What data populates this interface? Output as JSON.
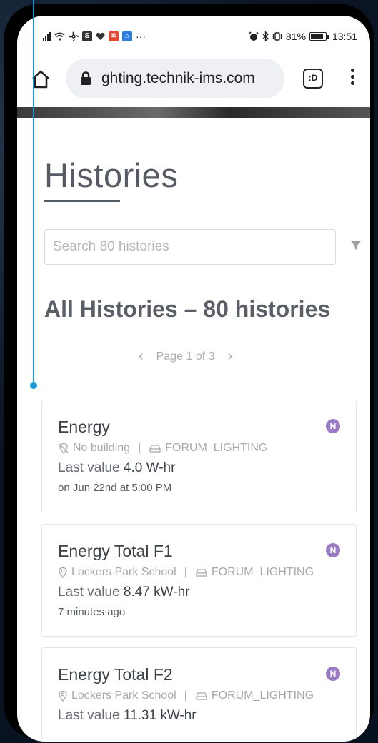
{
  "status_bar": {
    "time": "13:51",
    "battery_percent": "81%",
    "icons": [
      "signal-icon",
      "wifi-icon",
      "fan-icon",
      "s-app-icon",
      "heart-icon",
      "mail-icon",
      "home-app-icon",
      "more-dots-icon",
      "alarm-icon",
      "bluetooth-icon",
      "vibrate-icon",
      "battery-icon"
    ],
    "more_label": "···"
  },
  "browser": {
    "url": "ghting.technik-ims.com",
    "tab_label": ":D"
  },
  "page": {
    "title": "Histories",
    "search_placeholder": "Search 80 histories",
    "section_title": "All Histories – 80 histories",
    "pagination": {
      "label": "Page 1 of 3",
      "current": 1,
      "total": 3
    }
  },
  "histories": [
    {
      "name": "Energy",
      "building": "No building",
      "building_icon": "no-location-icon",
      "device": "FORUM_LIGHTING",
      "last_value_label": "Last value",
      "value": "4.0 W-hr",
      "timestamp": "on Jun 22nd at 5:00 PM",
      "badge": "N"
    },
    {
      "name": "Energy Total F1",
      "building": "Lockers Park School",
      "building_icon": "location-icon",
      "device": "FORUM_LIGHTING",
      "last_value_label": "Last value",
      "value": "8.47 kW-hr",
      "timestamp": "7 minutes ago",
      "badge": "N"
    },
    {
      "name": "Energy Total F2",
      "building": "Lockers Park School",
      "building_icon": "location-icon",
      "device": "FORUM_LIGHTING",
      "last_value_label": "Last value",
      "value": "11.31 kW-hr",
      "timestamp": "",
      "badge": "N"
    }
  ],
  "colors": {
    "badge": "#9b7cc4",
    "annotation": "#1a98d5",
    "title": "#555a63"
  }
}
